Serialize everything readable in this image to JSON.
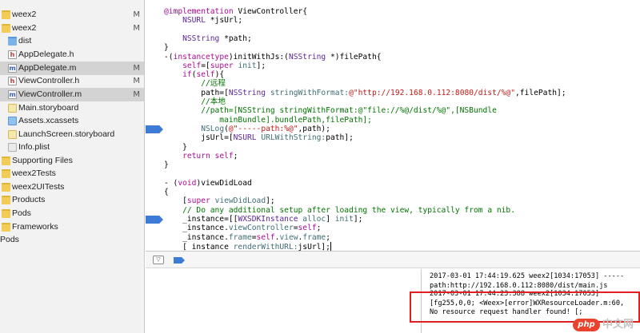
{
  "navigator": {
    "items": [
      {
        "label": "weex2",
        "icon": "folder-yellow-icon",
        "badge": "M",
        "selected": false
      },
      {
        "label": "weex2",
        "icon": "folder-yellow-icon",
        "badge": "M",
        "selected": false
      },
      {
        "label": "dist",
        "icon": "folder-blue-icon",
        "badge": "",
        "selected": false
      },
      {
        "label": "AppDelegate.h",
        "icon": "header-file-icon",
        "badge": "",
        "selected": false
      },
      {
        "label": "AppDelegate.m",
        "icon": "objc-file-icon",
        "badge": "M",
        "selected": true
      },
      {
        "label": "ViewController.h",
        "icon": "header-file-icon",
        "badge": "M",
        "selected": false
      },
      {
        "label": "ViewController.m",
        "icon": "objc-file-icon",
        "badge": "M",
        "selected": true
      },
      {
        "label": "Main.storyboard",
        "icon": "storyboard-icon",
        "badge": "",
        "selected": false
      },
      {
        "label": "Assets.xcassets",
        "icon": "asset-catalog-icon",
        "badge": "",
        "selected": false
      },
      {
        "label": "LaunchScreen.storyboard",
        "icon": "storyboard-icon",
        "badge": "",
        "selected": false
      },
      {
        "label": "Info.plist",
        "icon": "plist-file-icon",
        "badge": "",
        "selected": false
      },
      {
        "label": "Supporting Files",
        "icon": "folder-yellow-icon",
        "badge": "",
        "selected": false
      },
      {
        "label": "weex2Tests",
        "icon": "folder-yellow-icon",
        "badge": "",
        "selected": false
      },
      {
        "label": "weex2UITests",
        "icon": "folder-yellow-icon",
        "badge": "",
        "selected": false
      },
      {
        "label": "Products",
        "icon": "folder-yellow-icon",
        "badge": "",
        "selected": false
      },
      {
        "label": "Pods",
        "icon": "folder-yellow-icon",
        "badge": "",
        "selected": false
      },
      {
        "label": "Frameworks",
        "icon": "folder-yellow-icon",
        "badge": "",
        "selected": false
      },
      {
        "label": "Pods",
        "icon": "project-icon",
        "badge": "",
        "selected": false
      }
    ]
  },
  "editor": {
    "lines": [
      [
        [
          "kw",
          "@implementation"
        ],
        [
          "",
          " ViewController{"
        ]
      ],
      [
        [
          "",
          "    "
        ],
        [
          "typ",
          "NSURL"
        ],
        [
          "",
          " *jsUrl;"
        ]
      ],
      [
        [
          "",
          ""
        ]
      ],
      [
        [
          "",
          "    "
        ],
        [
          "typ",
          "NSString"
        ],
        [
          "",
          " *path;"
        ]
      ],
      [
        [
          "",
          "}"
        ]
      ],
      [
        [
          "",
          "-("
        ],
        [
          "kw",
          "instancetype"
        ],
        [
          "",
          ")initWithJs:("
        ],
        [
          "typ",
          "NSString"
        ],
        [
          "",
          " *)filePath{"
        ]
      ],
      [
        [
          "",
          "    "
        ],
        [
          "kw",
          "self"
        ],
        [
          "",
          "=["
        ],
        [
          "kw",
          "super"
        ],
        [
          "",
          " "
        ],
        [
          "mth",
          "init"
        ],
        [
          "",
          "];"
        ]
      ],
      [
        [
          "",
          "    "
        ],
        [
          "kw",
          "if"
        ],
        [
          "",
          "("
        ],
        [
          "kw",
          "self"
        ],
        [
          "",
          "){"
        ]
      ],
      [
        [
          "cmt",
          "        //远程"
        ]
      ],
      [
        [
          "",
          "        path=["
        ],
        [
          "typ",
          "NSString"
        ],
        [
          "",
          " "
        ],
        [
          "mth",
          "stringWithFormat:"
        ],
        [
          "str",
          "@\"http://192.168.0.112:8080/dist/%@\""
        ],
        [
          "",
          ",filePath];"
        ]
      ],
      [
        [
          "cmt",
          "        //本地"
        ]
      ],
      [
        [
          "cmt",
          "        //path=[NSString stringWithFormat:@\"file://%@/dist/%@\",[NSBundle"
        ]
      ],
      [
        [
          "cmt",
          "            mainBundle].bundlePath,filePath];"
        ]
      ],
      [
        [
          "",
          "        "
        ],
        [
          "mth",
          "NSLog"
        ],
        [
          "",
          "("
        ],
        [
          "str",
          "@\"-----path:%@\""
        ],
        [
          "",
          ",path);"
        ]
      ],
      [
        [
          "",
          "        jsUrl=["
        ],
        [
          "typ",
          "NSURL"
        ],
        [
          "",
          " "
        ],
        [
          "mth",
          "URLWithString:"
        ],
        [
          "",
          "path];"
        ]
      ],
      [
        [
          "",
          "    }"
        ]
      ],
      [
        [
          "",
          "    "
        ],
        [
          "kw",
          "return"
        ],
        [
          "",
          " "
        ],
        [
          "kw",
          "self"
        ],
        [
          "",
          ";"
        ]
      ],
      [
        [
          "",
          "}"
        ]
      ],
      [
        [
          "",
          ""
        ]
      ],
      [
        [
          "",
          "- ("
        ],
        [
          "kw",
          "void"
        ],
        [
          "",
          ")viewDidLoad"
        ]
      ],
      [
        [
          "",
          "{"
        ]
      ],
      [
        [
          "",
          "    ["
        ],
        [
          "kw",
          "super"
        ],
        [
          "",
          " "
        ],
        [
          "mth",
          "viewDidLoad"
        ],
        [
          "",
          "];"
        ]
      ],
      [
        [
          "cmt",
          "    // Do any additional setup after loading the view, typically from a nib."
        ]
      ],
      [
        [
          "",
          "    _instance=[["
        ],
        [
          "typ",
          "WXSDKInstance"
        ],
        [
          "",
          " "
        ],
        [
          "mth",
          "alloc"
        ],
        [
          "",
          "] "
        ],
        [
          "mth",
          "init"
        ],
        [
          "",
          "];"
        ]
      ],
      [
        [
          "",
          "    _instance."
        ],
        [
          "mth",
          "viewController"
        ],
        [
          "",
          "="
        ],
        [
          "kw",
          "self"
        ],
        [
          "",
          ";"
        ]
      ],
      [
        [
          "",
          "    _instance."
        ],
        [
          "mth",
          "frame"
        ],
        [
          "",
          "="
        ],
        [
          "kw",
          "self"
        ],
        [
          "",
          "."
        ],
        [
          "mth",
          "view"
        ],
        [
          "",
          "."
        ],
        [
          "mth",
          "frame"
        ],
        [
          "",
          ";"
        ]
      ],
      [
        [
          "",
          "    [_instance "
        ],
        [
          "mth",
          "renderWithURL:"
        ],
        [
          "",
          "jsUrl];"
        ]
      ]
    ],
    "breakpoint_lines": [
      13,
      23
    ]
  },
  "debug_bar": {
    "hide_icon": "hide-debug-area-icon",
    "breakpoints_icon": "breakpoint-toggle-icon"
  },
  "console": {
    "lines": [
      "2017-03-01 17:44:19.625 weex2[1034:17053] -----",
      "path:http://192.168.0.112:8080/dist/main.js",
      "2017-03-01 17:44:23.388 weex2[1034:17053]",
      "[fg255,0,0; <Weex>[error]WXResourceLoader.m:60,",
      "No resource request handler found! [;"
    ]
  },
  "watermark": {
    "logo_text": "php",
    "text": "中文网"
  }
}
